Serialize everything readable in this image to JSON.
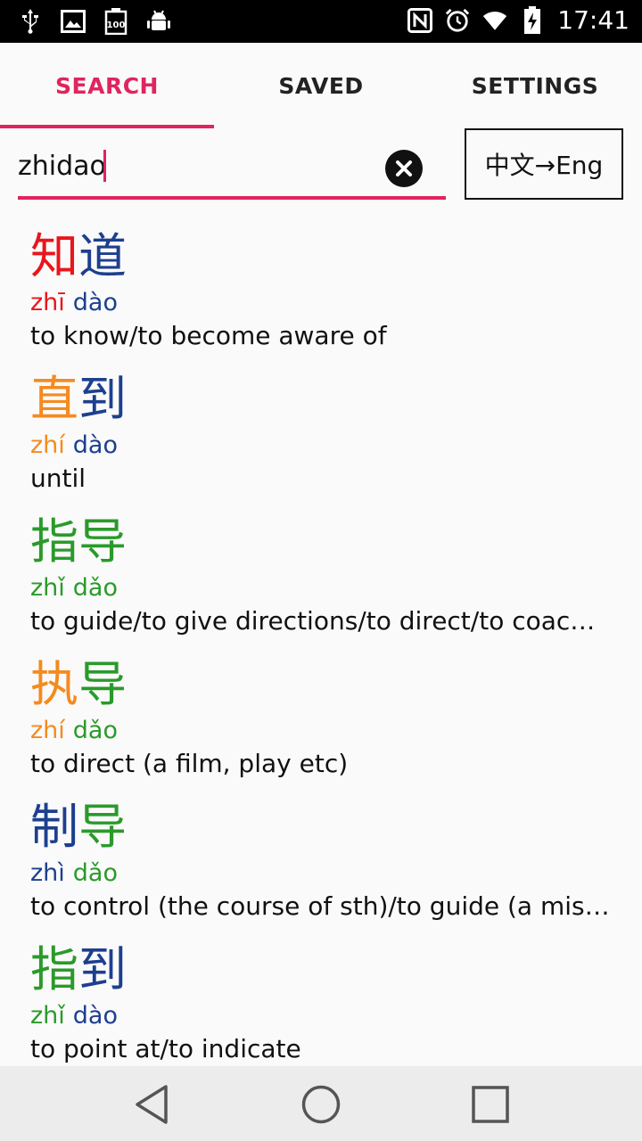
{
  "status_bar": {
    "time": "17:41",
    "left_icons": [
      "usb-icon",
      "image-icon",
      "battery-100-icon",
      "android-debug-icon"
    ],
    "right_icons": [
      "nfc-icon",
      "alarm-icon",
      "wifi-icon",
      "battery-charging-icon"
    ]
  },
  "tabs": [
    {
      "label": "SEARCH",
      "active": true
    },
    {
      "label": "SAVED",
      "active": false
    },
    {
      "label": "SETTINGS",
      "active": false
    }
  ],
  "search": {
    "value": "zhidao",
    "placeholder": ""
  },
  "mode_button": {
    "label": "中文→Eng"
  },
  "colors": {
    "accent": "#e0245e",
    "tone1": "#e8161b",
    "tone2": "#f58a1f",
    "tone3": "#2a9a2a",
    "tone4": "#1d3f8f"
  },
  "results": [
    {
      "chars": [
        {
          "c": "知",
          "tone": 1
        },
        {
          "c": "道",
          "tone": 4
        }
      ],
      "syllables": [
        {
          "p": "zhī",
          "tone": 1
        },
        {
          "p": "dào",
          "tone": 4
        }
      ],
      "definition": "to know/to become aware of"
    },
    {
      "chars": [
        {
          "c": "直",
          "tone": 2
        },
        {
          "c": "到",
          "tone": 4
        }
      ],
      "syllables": [
        {
          "p": "zhí",
          "tone": 2
        },
        {
          "p": "dào",
          "tone": 4
        }
      ],
      "definition": "until"
    },
    {
      "chars": [
        {
          "c": "指",
          "tone": 3
        },
        {
          "c": "导",
          "tone": 3
        }
      ],
      "syllables": [
        {
          "p": "zhǐ",
          "tone": 3
        },
        {
          "p": "dǎo",
          "tone": 3
        }
      ],
      "definition": "to guide/to give directions/to direct/to coac…"
    },
    {
      "chars": [
        {
          "c": "执",
          "tone": 2
        },
        {
          "c": "导",
          "tone": 3
        }
      ],
      "syllables": [
        {
          "p": "zhí",
          "tone": 2
        },
        {
          "p": "dǎo",
          "tone": 3
        }
      ],
      "definition": "to direct (a film, play etc)"
    },
    {
      "chars": [
        {
          "c": "制",
          "tone": 4
        },
        {
          "c": "导",
          "tone": 3
        }
      ],
      "syllables": [
        {
          "p": "zhì",
          "tone": 4
        },
        {
          "p": "dǎo",
          "tone": 3
        }
      ],
      "definition": "to control (the course of sth)/to guide (a mis…"
    },
    {
      "chars": [
        {
          "c": "指",
          "tone": 3
        },
        {
          "c": "到",
          "tone": 4
        }
      ],
      "syllables": [
        {
          "p": "zhǐ",
          "tone": 3
        },
        {
          "p": "dào",
          "tone": 4
        }
      ],
      "definition": "to point at/to indicate"
    }
  ],
  "nav": {
    "icons": [
      "back-icon",
      "home-icon",
      "recents-icon"
    ]
  }
}
